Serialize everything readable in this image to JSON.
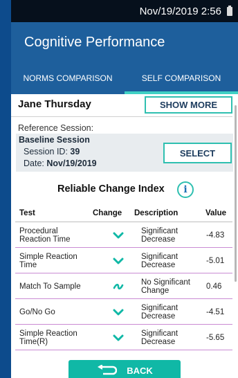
{
  "status": {
    "datetime": "Nov/19/2019 2:56"
  },
  "app": {
    "title": "Cognitive Performance"
  },
  "tabs": [
    {
      "label": "NORMS COMPARISON",
      "active": false
    },
    {
      "label": "SELF COMPARISON",
      "active": true
    }
  ],
  "patient": {
    "name": "Jane Thursday",
    "show_more": "SHOW MORE"
  },
  "reference": {
    "label": "Reference Session:",
    "title": "Baseline Session",
    "session_id_label": "Session ID: ",
    "session_id": "39",
    "date_label": "Date: ",
    "date": "Nov/19/2019",
    "select": "SELECT"
  },
  "rci": {
    "title": "Reliable Change Index",
    "info_icon": "i"
  },
  "table": {
    "headers": {
      "test": "Test",
      "change": "Change",
      "description": "Description",
      "value": "Value"
    },
    "rows": [
      {
        "test1": "Procedural",
        "test2": "Reaction Time",
        "change": "chevron-down",
        "desc1": "Significant",
        "desc2": "Decrease",
        "value": "-4.83"
      },
      {
        "test1": "Simple Reaction",
        "test2": "Time",
        "change": "chevron-down",
        "desc1": "Significant",
        "desc2": "Decrease",
        "value": "-5.01"
      },
      {
        "test1": "Match To Sample",
        "test2": "",
        "change": "tilde",
        "desc1": "No Significant",
        "desc2": "Change",
        "value": "0.46"
      },
      {
        "test1": "Go/No Go",
        "test2": "",
        "change": "chevron-down",
        "desc1": "Significant",
        "desc2": "Decrease",
        "value": "-4.51"
      },
      {
        "test1": "Simple Reaction",
        "test2": "Time(R)",
        "change": "chevron-down",
        "desc1": "Significant",
        "desc2": "Decrease",
        "value": "-5.65"
      }
    ]
  },
  "back": {
    "label": "BACK"
  },
  "colors": {
    "accent": "#2ebfb0",
    "appbar": "#1e5f9c",
    "button": "#10b8a6",
    "divider": "#c98ad3"
  }
}
